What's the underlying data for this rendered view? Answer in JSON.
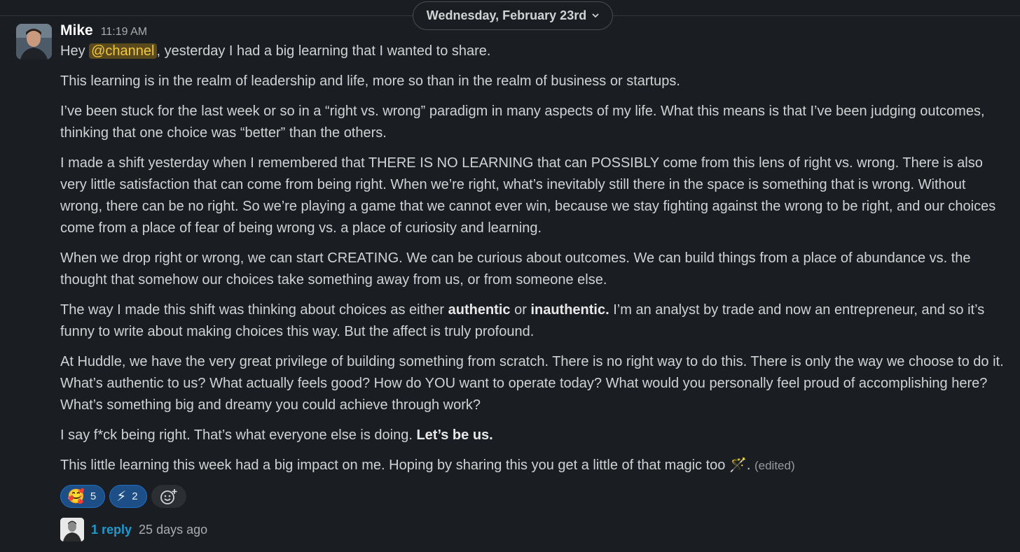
{
  "date_divider": {
    "label": "Wednesday, February 23rd",
    "icon": "chevron-down-icon"
  },
  "message": {
    "author": "Mike",
    "time": "11:19 AM",
    "greeting_before": "Hey ",
    "mention": "@channel",
    "greeting_after": ", yesterday I had a big learning that I wanted to share.",
    "p2": "This learning is in the realm of leadership and life, more so than in the realm of business or startups.",
    "p3": "I’ve been stuck for the last week or so in a “right vs. wrong” paradigm in many aspects of my life. What this means is that I’ve been judging outcomes, thinking that one choice was “better” than the others.",
    "p4": "I made a shift yesterday when I remembered that THERE IS NO LEARNING that can POSSIBLY come from this lens of right vs. wrong. There is also very little satisfaction that can come from being right. When we’re right, what’s inevitably still there in the space is something that is wrong. Without wrong, there can be no right. So we’re playing a game that we cannot ever win, because we stay fighting against the wrong to be right, and our choices come from a place of fear of being wrong vs. a place of curiosity and learning.",
    "p5": "When we drop right or wrong, we can start CREATING. We can be curious about outcomes. We can build things from a place of abundance vs. the thought that somehow our choices take something away from us, or from someone else.",
    "p6_a": "The way I made this shift was thinking about choices as either ",
    "p6_b": "authentic",
    "p6_c": " or ",
    "p6_d": "inauthentic.",
    "p6_e": " I’m an analyst by trade and now an entrepreneur, and so it’s funny to write about making choices this way. But the affect is truly profound.",
    "p7": "At Huddle, we have the very great privilege of building something from scratch. There is no right way to do this. There is only the way we choose to do it. What’s authentic to us? What actually feels good? How do YOU want to operate today? What would you personally feel proud of accomplishing here? What’s something big and dreamy you could achieve through work?",
    "p8_a": "I say f*ck being right. That’s what everyone else is doing. ",
    "p8_b": "Let’s be us.",
    "p9_a": "This little learning this week had a big impact on me. Hoping by sharing this you get a little of that magic too ",
    "p9_emoji": "🪄",
    "p9_b": ". ",
    "edited": "(edited)"
  },
  "reactions": [
    {
      "emoji": "🥰",
      "count": "5"
    },
    {
      "emoji": "⚡",
      "count": "2"
    }
  ],
  "add_reaction_icon": "add-emoji-icon",
  "thread": {
    "replies": "1 reply",
    "time": "25 days ago"
  },
  "colors": {
    "background": "#1a1d21",
    "mention_bg": "#5b4a1c",
    "mention_text": "#f2c744",
    "link": "#1d9bd1",
    "reaction_bg": "#1d4f86"
  }
}
